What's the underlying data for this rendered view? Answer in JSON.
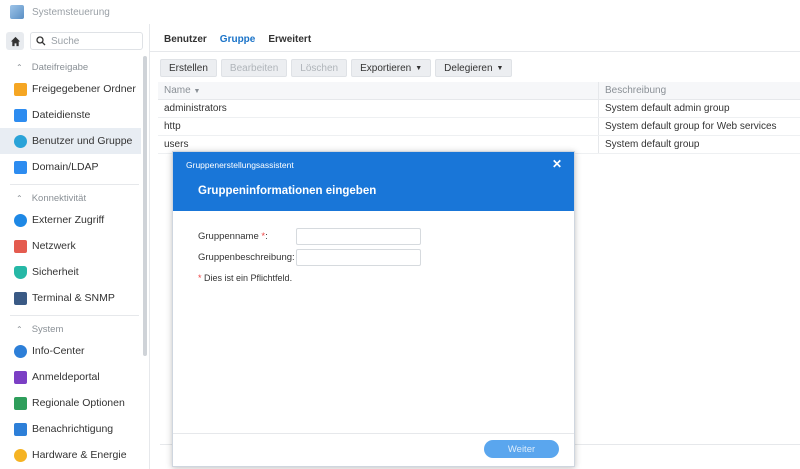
{
  "app": {
    "title": "Systemsteuerung"
  },
  "search": {
    "placeholder": "Suche"
  },
  "sidebar": {
    "sections": [
      {
        "label": "Dateifreigabe",
        "items": [
          {
            "label": "Freigegebener Ordner",
            "icon": "folder-icon",
            "color": "#f5a623"
          },
          {
            "label": "Dateidienste",
            "icon": "file-services-icon",
            "color": "#2d8cf0"
          },
          {
            "label": "Benutzer und Gruppe",
            "icon": "users-icon",
            "color": "#2aa3d8",
            "active": true
          },
          {
            "label": "Domain/LDAP",
            "icon": "domain-icon",
            "color": "#2d8cf0"
          }
        ]
      },
      {
        "label": "Konnektivität",
        "items": [
          {
            "label": "Externer Zugriff",
            "icon": "external-access-icon",
            "color": "#1e88e5"
          },
          {
            "label": "Netzwerk",
            "icon": "network-home-icon",
            "color": "#e45b4f"
          },
          {
            "label": "Sicherheit",
            "icon": "shield-icon",
            "color": "#26b8a6"
          },
          {
            "label": "Terminal & SNMP",
            "icon": "terminal-icon",
            "color": "#3a5a85"
          }
        ]
      },
      {
        "label": "System",
        "items": [
          {
            "label": "Info-Center",
            "icon": "info-icon",
            "color": "#2d7fd8"
          },
          {
            "label": "Anmeldeportal",
            "icon": "login-portal-icon",
            "color": "#7b3fc4"
          },
          {
            "label": "Regionale Optionen",
            "icon": "globe-icon",
            "color": "#2e9e5b"
          },
          {
            "label": "Benachrichtigung",
            "icon": "notification-icon",
            "color": "#2d7fd8"
          },
          {
            "label": "Hardware & Energie",
            "icon": "bulb-icon",
            "color": "#f5b323"
          }
        ]
      }
    ]
  },
  "tabs": [
    {
      "label": "Benutzer"
    },
    {
      "label": "Gruppe",
      "active": true
    },
    {
      "label": "Erweitert"
    }
  ],
  "toolbar": {
    "create": "Erstellen",
    "edit": "Bearbeiten",
    "delete": "Löschen",
    "export": "Exportieren",
    "delegate": "Delegieren"
  },
  "table": {
    "headers": {
      "name": "Name",
      "description": "Beschreibung"
    },
    "rows": [
      {
        "name": "administrators",
        "description": "System default admin group"
      },
      {
        "name": "http",
        "description": "System default group for Web services"
      },
      {
        "name": "users",
        "description": "System default group"
      }
    ]
  },
  "dialog": {
    "title": "Gruppenerstellungsassistent",
    "heading": "Gruppeninformationen eingeben",
    "name_label": "Gruppenname",
    "desc_label": "Gruppenbeschreibung:",
    "name_value": "",
    "desc_value": "",
    "required_note": "Dies ist ein Pflichtfeld.",
    "next": "Weiter"
  },
  "colors": {
    "accent": "#1976d8",
    "button_disabled": "#5aa6ee"
  }
}
